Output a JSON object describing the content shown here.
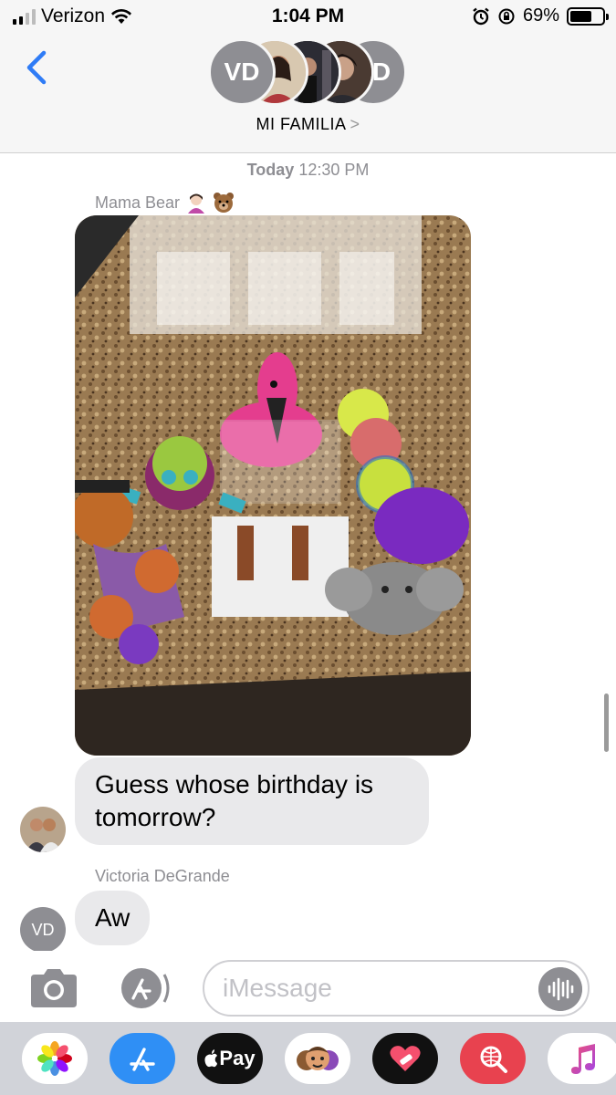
{
  "status_bar": {
    "carrier": "Verizon",
    "time": "1:04 PM",
    "battery": "69%",
    "battery_level": 0.69
  },
  "header": {
    "avatars": [
      "VD",
      "D"
    ],
    "group_name": "MI FAMILIA",
    "chevron": ">"
  },
  "conversation": {
    "timestamp_day": "Today",
    "timestamp_time": "12:30 PM",
    "messages": [
      {
        "sender": "Mama Bear",
        "type": "photo"
      },
      {
        "type": "text",
        "text": "Guess whose birthday is tomorrow?"
      },
      {
        "sender": "Victoria DeGrande",
        "avatar": "VD",
        "type": "text",
        "text": "Aw"
      }
    ]
  },
  "input": {
    "placeholder": "iMessage"
  },
  "app_drawer": {
    "icons": [
      "photos-icon",
      "app-store-icon",
      "apple-pay-icon",
      "memoji-icon",
      "heart-app-icon",
      "search-web-icon",
      "music-icon"
    ],
    "apple_pay_label": "Pay"
  },
  "colors": {
    "accent": "#2f7cf6",
    "bubble_gray": "#e9e9eb",
    "meta_gray": "#8e8e93"
  }
}
